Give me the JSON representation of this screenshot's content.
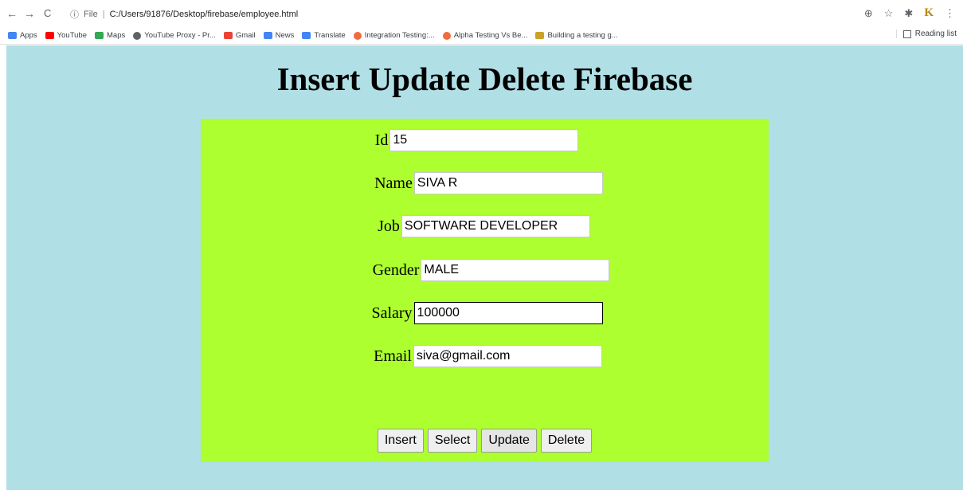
{
  "browser": {
    "nav": {
      "back": "←",
      "forward": "→",
      "reload": "C"
    },
    "url_prefix": "File",
    "url": "C:/Users/91876/Desktop/firebase/employee.html",
    "bookmarks": [
      {
        "label": "Apps",
        "color": "#4285f4"
      },
      {
        "label": "YouTube",
        "color": "#ff0000"
      },
      {
        "label": "Maps",
        "color": "#34a853"
      },
      {
        "label": "YouTube Proxy - Pr...",
        "color": "#5f6368"
      },
      {
        "label": "Gmail",
        "color": "#ea4335"
      },
      {
        "label": "News",
        "color": "#4285f4"
      },
      {
        "label": "Translate",
        "color": "#4285f4"
      },
      {
        "label": "Integration Testing:...",
        "color": "#f26b3a"
      },
      {
        "label": "Alpha Testing Vs Be...",
        "color": "#f26b3a"
      },
      {
        "label": "Building a testing g...",
        "color": "#c9a227"
      }
    ],
    "reading_list": "Reading list"
  },
  "page": {
    "title": "Insert Update Delete Firebase",
    "background": "#b0e0e6",
    "panel_color": "#adff2f"
  },
  "form": {
    "fields": [
      {
        "label": "Id",
        "value": "15"
      },
      {
        "label": "Name",
        "value": "SIVA R"
      },
      {
        "label": "Job",
        "value": "SOFTWARE DEVELOPER"
      },
      {
        "label": "Gender",
        "value": "MALE"
      },
      {
        "label": "Salary",
        "value": "100000"
      },
      {
        "label": "Email",
        "value": "siva@gmail.com"
      }
    ],
    "buttons": {
      "insert": "Insert",
      "select": "Select",
      "update": "Update",
      "delete": "Delete"
    }
  }
}
